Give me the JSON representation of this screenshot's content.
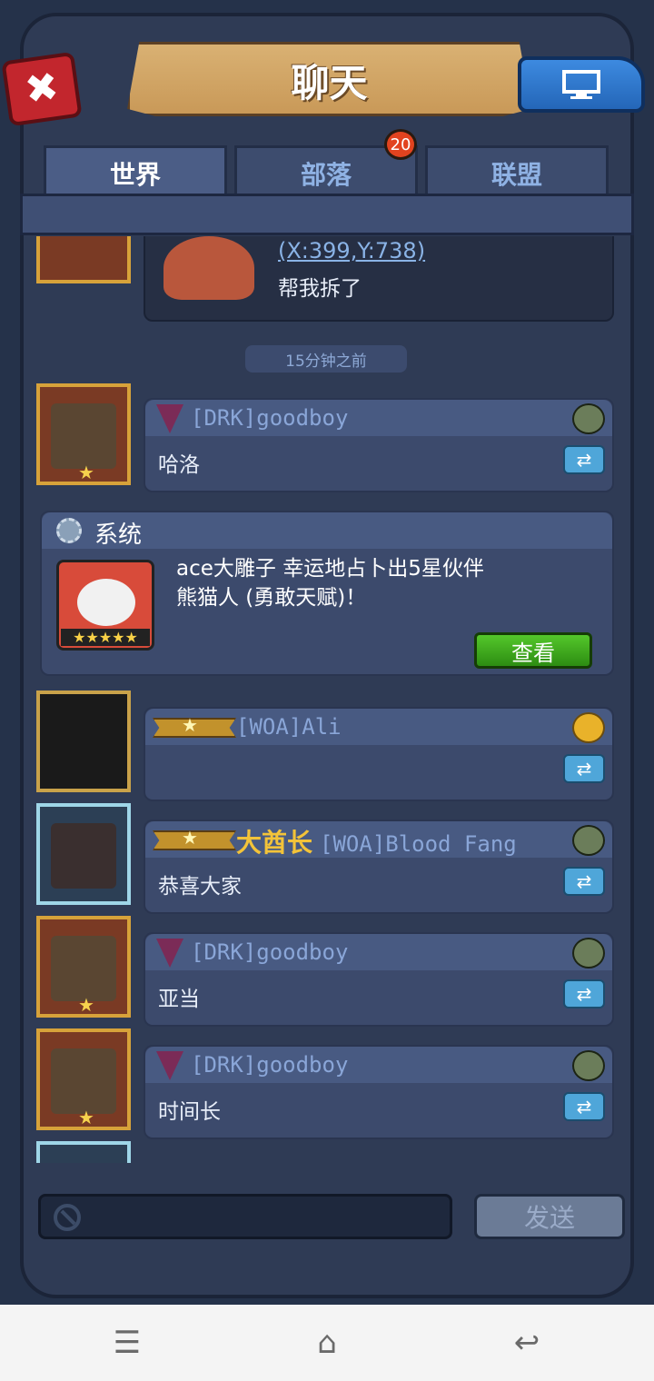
{
  "header": {
    "title": "聊天"
  },
  "tabs": [
    {
      "label": "世界",
      "active": true
    },
    {
      "label": "部落",
      "badge": "20"
    },
    {
      "label": "联盟"
    }
  ],
  "chat": {
    "location_message": {
      "coords": "(X:399,Y:738)",
      "text": "帮我拆了"
    },
    "timestamp": "15分钟之前",
    "messages": [
      {
        "tag": "[DRK]goodboy",
        "text": "哈洛"
      },
      {
        "tag": "[WOA]Ali",
        "text": ""
      },
      {
        "title": "大酋长",
        "tag": "[WOA]Blood Fang",
        "text": "恭喜大家"
      },
      {
        "tag": "[DRK]goodboy",
        "text": "亚当"
      },
      {
        "tag": "[DRK]goodboy",
        "text": "时间长"
      }
    ],
    "system": {
      "title": "系统",
      "line1": "ace大雕子 幸运地占卜出5星伙伴",
      "line2": "熊猫人 (勇敢天赋)！",
      "stars": "★★★★★",
      "button": "查看"
    }
  },
  "input": {
    "send_label": "发送"
  },
  "icons": {
    "close": "close-icon",
    "screen": "monitor-icon",
    "share": "share-arrows-icon",
    "ban": "no-entry-icon",
    "nav_menu": "menu-icon",
    "nav_home": "home-icon",
    "nav_back": "back-icon"
  },
  "colors": {
    "accent": "#f3c339",
    "panel": "#3c4a6c",
    "header_bar": "#485a82"
  }
}
